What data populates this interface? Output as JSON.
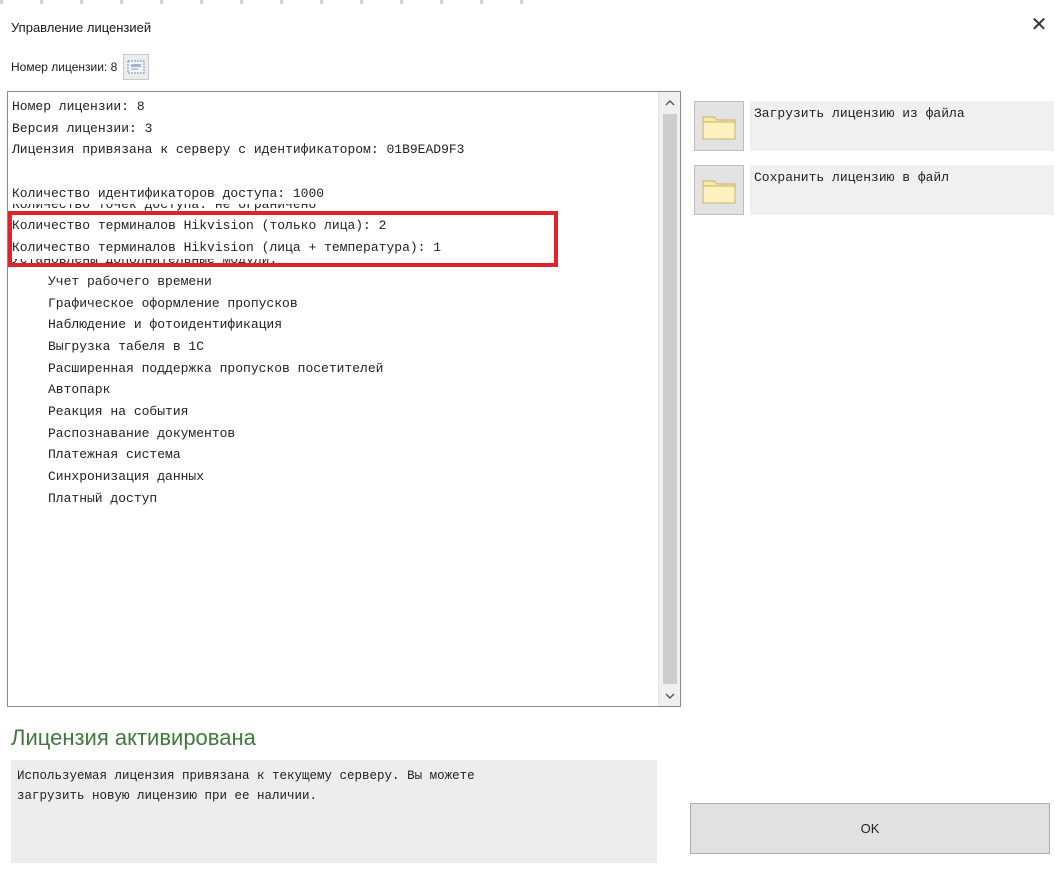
{
  "window": {
    "title": "Управление лицензией",
    "close_symbol": "✕"
  },
  "license_number_row": {
    "label": "Номер лицензии: 8"
  },
  "details": {
    "lines": [
      "Номер лицензии: 8",
      "Версия лицензии: 3",
      "Лицензия привязана к серверу с идентификатором: 01B9EAD9F3",
      "",
      "Количество идентификаторов доступа: 1000",
      "Количество точек доступа: не ограничено",
      "Количество терминалов Hikvision (только лица): 2",
      "Количество терминалов Hikvision (лица + температура): 1",
      "Установлены дополнительные модули:"
    ],
    "modules": [
      "Учет рабочего времени",
      "Графическое оформление пропусков",
      "Наблюдение и фотоидентификация",
      "Выгрузка табеля в 1С",
      "Расширенная поддержка пропусков посетителей",
      "Автопарк",
      "Реакция на события",
      "Распознавание документов",
      "Платежная система",
      "Синхронизация данных",
      "Платный доступ"
    ]
  },
  "status": {
    "title": "Лицензия активирована",
    "description_line1": "Используемая лицензия привязана к текущему серверу. Вы можете",
    "description_line2": "загрузить новую лицензию при ее наличии."
  },
  "actions": {
    "load_label": "Загрузить лицензию из файла",
    "save_label": "Сохранить лицензию в файл"
  },
  "ok_label": "OK",
  "colors": {
    "status_green": "#3f7a3a",
    "highlight_red": "#e0232a",
    "folder_yellow": "#fbe9a0"
  },
  "icons": {
    "close": "close-icon",
    "id_button": "id-card-icon",
    "folder": "folder-icon",
    "scroll_up": "chevron-up-icon",
    "scroll_down": "chevron-down-icon"
  }
}
